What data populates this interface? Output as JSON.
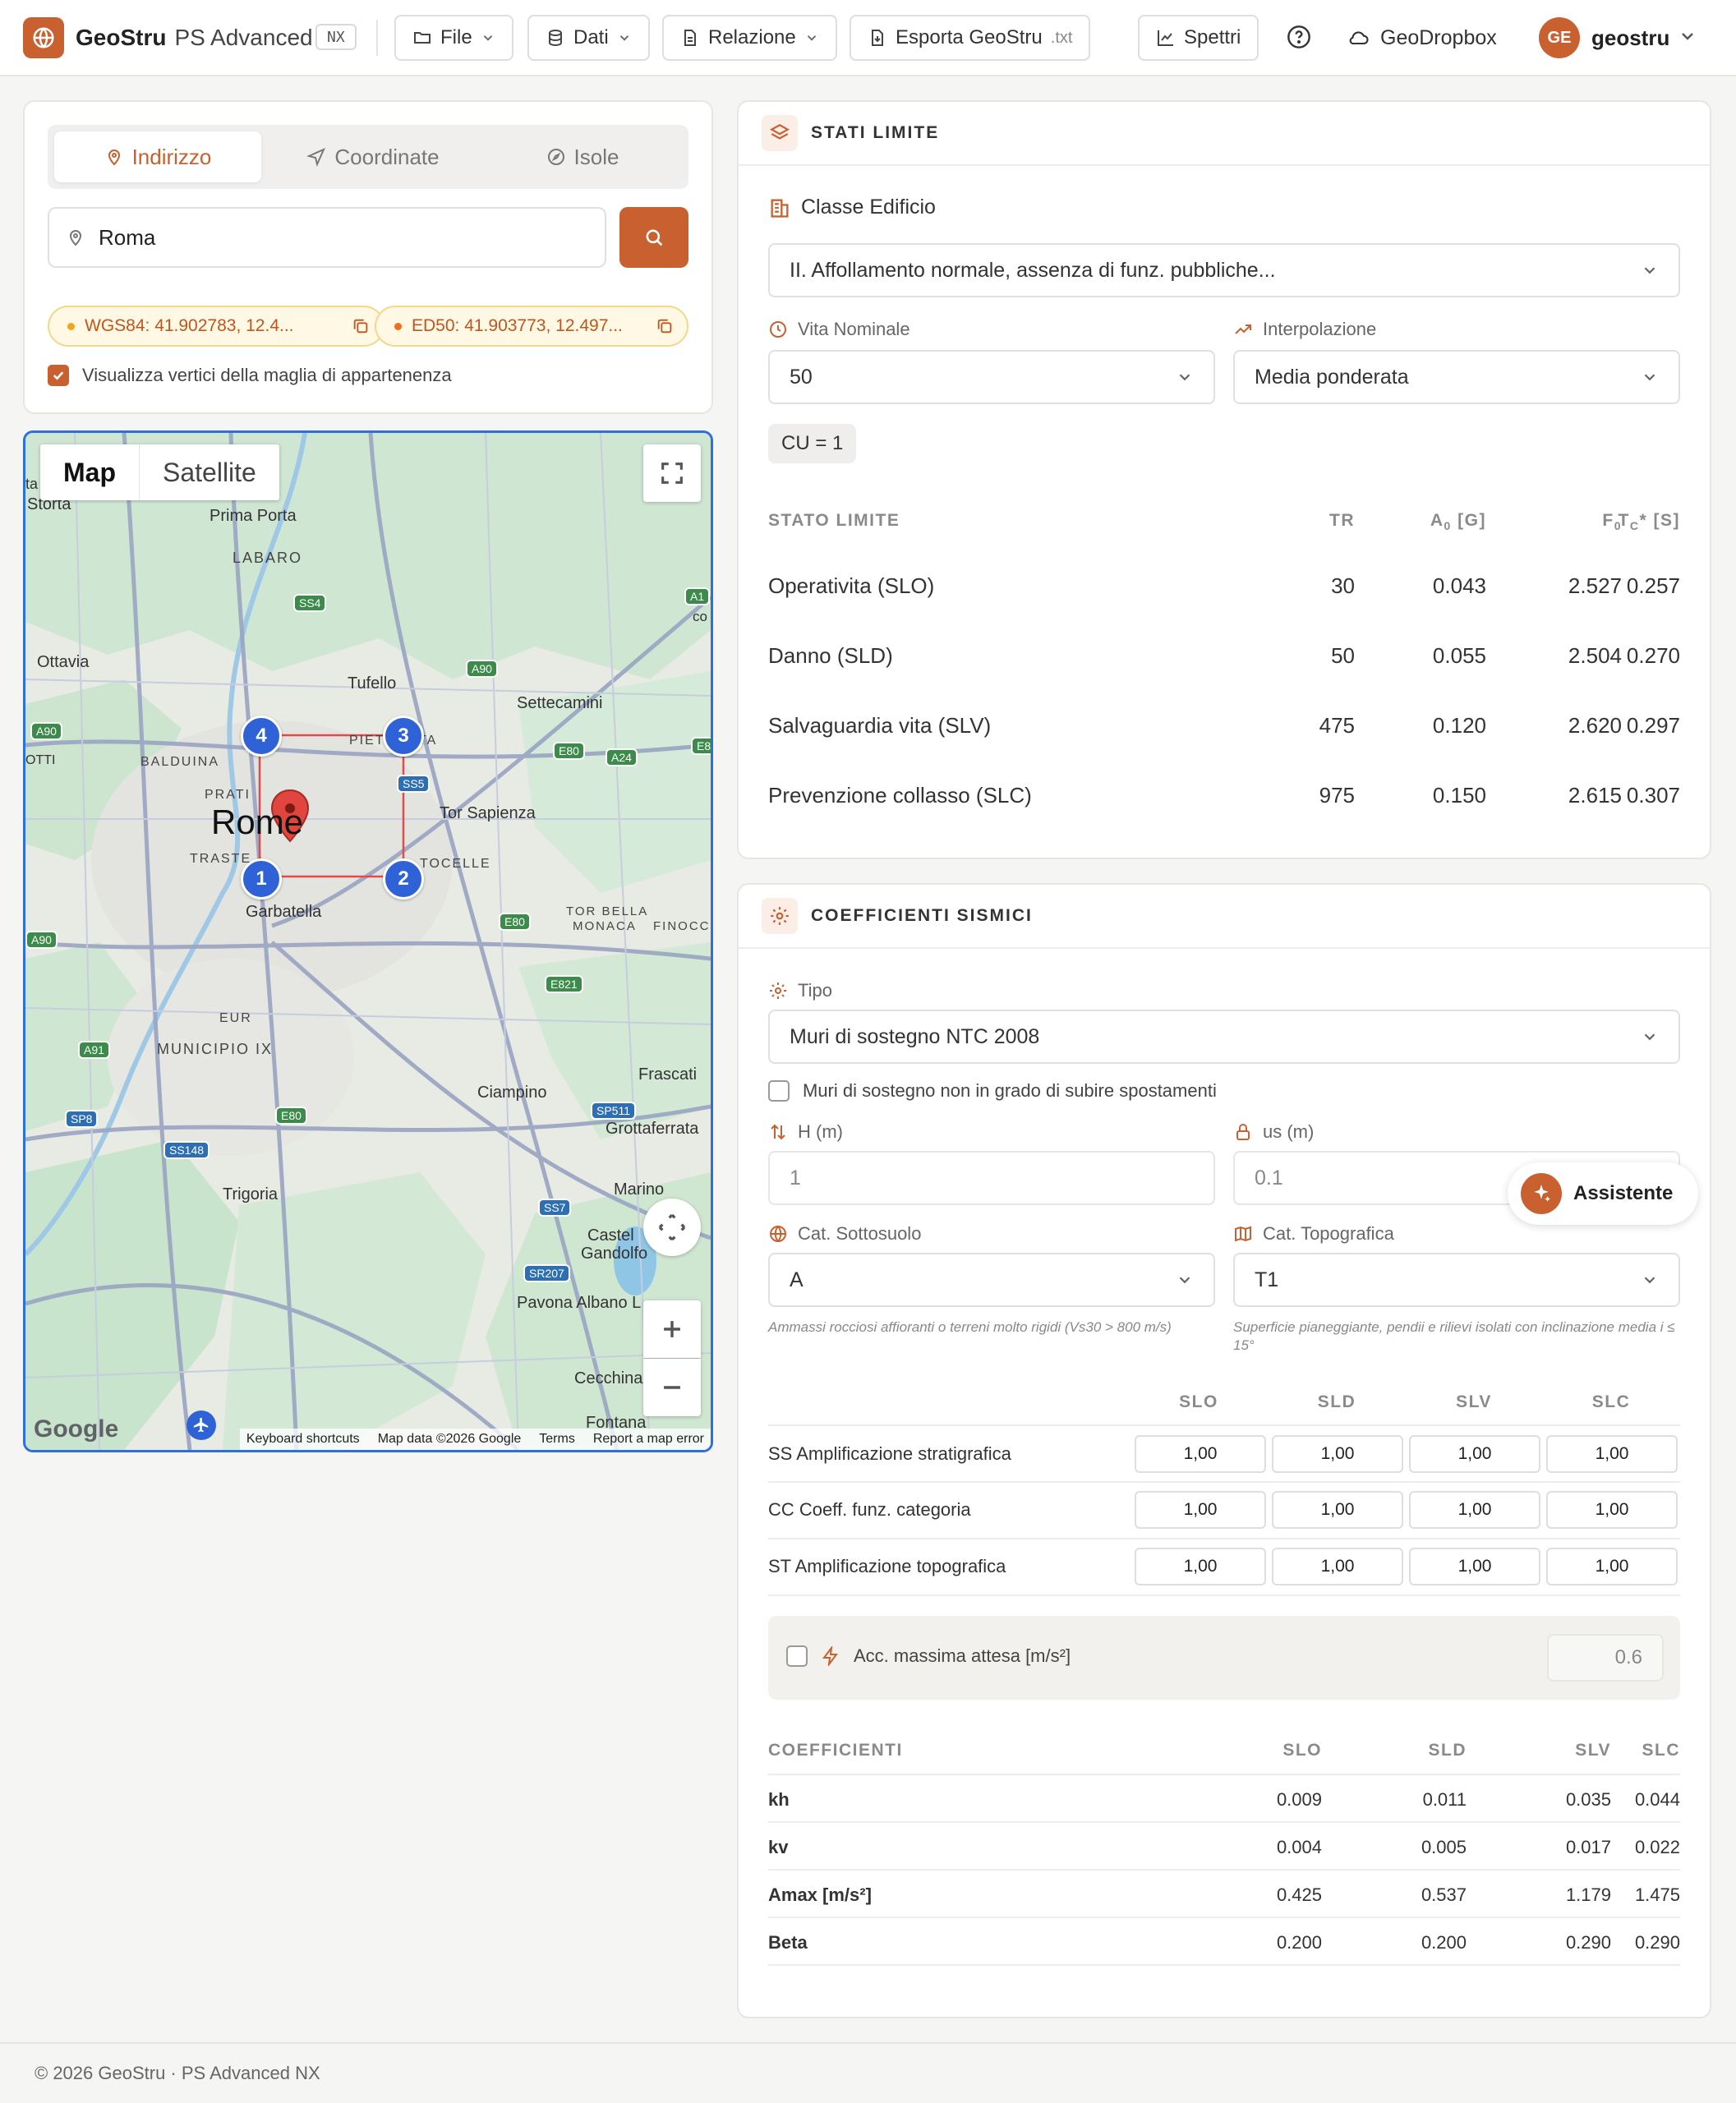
{
  "header": {
    "brand": "GeoStru",
    "product": "PS Advanced",
    "badge": "NX",
    "menu": {
      "file": "File",
      "dati": "Dati",
      "relazione": "Relazione",
      "esporta": "Esporta GeoStru",
      "esporta_ext": ".txt",
      "spettri": "Spettri",
      "dropbox": "GeoDropbox"
    },
    "user": {
      "initials": "GE",
      "name": "geostru"
    }
  },
  "search": {
    "tabs": [
      "Indirizzo",
      "Coordinate",
      "Isole"
    ],
    "query": "Roma",
    "wgs84": "WGS84: 41.902783, 12.4...",
    "ed50": "ED50: 41.903773, 12.497...",
    "show_vertices_label": "Visualizza vertici della maglia di appartenenza",
    "show_vertices_checked": true
  },
  "map": {
    "toggle": [
      "Map",
      "Satellite"
    ],
    "labels": {
      "storta": "Storta",
      "prima_porta": "Prima Porta",
      "labaro": "LABARO",
      "ottavia": "Ottavia",
      "tufello": "Tufello",
      "settecamini": "Settecamini",
      "balduina": "BALDUINA",
      "prati": "PRATI",
      "rome": "Rome",
      "trastevere": "TRASTE",
      "tor_sapienza": "Tor Sapienza",
      "tocelle": "TOCELLE",
      "garbatella": "Garbatella",
      "tor_bella": "TOR BELLA",
      "monaca": "MONACA",
      "finocchio": "FINOCC",
      "eur": "EUR",
      "municipio": "MUNICIPIO IX",
      "frascati": "Frascati",
      "ciampino": "Ciampino",
      "grottaferrata": "Grottaferrata",
      "trigoria": "Trigoria",
      "marino": "Marino",
      "castel": "Castel",
      "gandolfo": "Gandolfo",
      "pavona": "Pavona Albano L",
      "cecchina": "Cecchina",
      "fontana": "Fontana",
      "pietralata": "PIET",
      "ta": "TA",
      "ta_left": "ta",
      "co": "co",
      "otti": "OTTI"
    },
    "roads": {
      "ss4": "SS4",
      "a90": "A90",
      "a1": "A1",
      "e80": "E80",
      "a24": "A24",
      "ss5": "SS5",
      "e821": "E821",
      "a91": "A91",
      "sp8": "SP8",
      "ss148": "SS148",
      "sp511": "SP511",
      "ss7": "SS7",
      "sr207": "SR207",
      "e8": "E8"
    },
    "markers": [
      "1",
      "2",
      "3",
      "4"
    ],
    "footer": {
      "google": "Google",
      "shortcuts": "Keyboard shortcuts",
      "data": "Map data ©2026 Google",
      "terms": "Terms",
      "report": "Report a map error"
    }
  },
  "stati_limite": {
    "title": "STATI LIMITE",
    "classe_label": "Classe Edificio",
    "classe_value": "II. Affollamento normale, assenza di funz. pubbliche...",
    "vita_label": "Vita Nominale",
    "vita_value": "50",
    "interp_label": "Interpolazione",
    "interp_value": "Media ponderata",
    "cu": "CU = 1",
    "columns": {
      "stato": "STATO LIMITE",
      "tr": "TR",
      "ag": "A",
      "ag_sub": "G",
      "ag_unit": " [G]",
      "f0": "F",
      "f0_sub": "0",
      "tc": "T",
      "tc_sub": "C",
      "tc_unit": "* [S]",
      "ag_sub0": "0"
    },
    "rows": [
      {
        "name": "Operativita (SLO)",
        "tr": "30",
        "ag": "0.043",
        "f0": "2.527",
        "tc": "0.257"
      },
      {
        "name": "Danno (SLD)",
        "tr": "50",
        "ag": "0.055",
        "f0": "2.504",
        "tc": "0.270"
      },
      {
        "name": "Salvaguardia vita (SLV)",
        "tr": "475",
        "ag": "0.120",
        "f0": "2.620",
        "tc": "0.297"
      },
      {
        "name": "Prevenzione collasso (SLC)",
        "tr": "975",
        "ag": "0.150",
        "f0": "2.615",
        "tc": "0.307"
      }
    ]
  },
  "coefficienti": {
    "title": "COEFFICIENTI SISMICI",
    "tipo_label": "Tipo",
    "tipo_value": "Muri di sostegno NTC 2008",
    "muri_label": "Muri di sostegno non in grado di subire spostamenti",
    "muri_checked": false,
    "h_label": "H (m)",
    "h_value": "1",
    "us_label": "us (m)",
    "us_value": "0.1",
    "sottosuolo_label": "Cat. Sottosuolo",
    "sottosuolo_value": "A",
    "sottosuolo_hint": "Ammassi rocciosi affioranti o terreni molto rigidi (Vs30 > 800 m/s)",
    "topo_label": "Cat. Topografica",
    "topo_value": "T1",
    "topo_hint": "Superficie pianeggiante, pendii e rilievi isolati con inclinazione media i ≤ 15°",
    "amp_headers": [
      "SLO",
      "SLD",
      "SLV",
      "SLC"
    ],
    "amp_rows": [
      {
        "label": "SS Amplificazione stratigrafica",
        "values": [
          "1,00",
          "1,00",
          "1,00",
          "1,00"
        ]
      },
      {
        "label": "CC Coeff. funz. categoria",
        "values": [
          "1,00",
          "1,00",
          "1,00",
          "1,00"
        ]
      },
      {
        "label": "ST Amplificazione topografica",
        "values": [
          "1,00",
          "1,00",
          "1,00",
          "1,00"
        ]
      }
    ],
    "acc_label": "Acc. massima attesa [m/s²]",
    "acc_checked": false,
    "acc_value": "0.6",
    "coef_headers": [
      "COEFFICIENTI",
      "SLO",
      "SLD",
      "SLV",
      "SLC"
    ],
    "coef_rows": [
      {
        "label": "kh",
        "values": [
          "0.009",
          "0.011",
          "0.035",
          "0.044"
        ]
      },
      {
        "label": "kv",
        "values": [
          "0.004",
          "0.005",
          "0.017",
          "0.022"
        ]
      },
      {
        "label": "Amax [m/s²]",
        "values": [
          "0.425",
          "0.537",
          "1.179",
          "1.475"
        ]
      },
      {
        "label": "Beta",
        "values": [
          "0.200",
          "0.200",
          "0.290",
          "0.290"
        ]
      }
    ]
  },
  "assistant": {
    "label": "Assistente"
  },
  "footer": {
    "text": "© 2026 GeoStru · PS Advanced NX"
  },
  "colors": {
    "accent": "#c9602f",
    "map_border": "#2f6fdd",
    "marker": "#2f62d7"
  }
}
